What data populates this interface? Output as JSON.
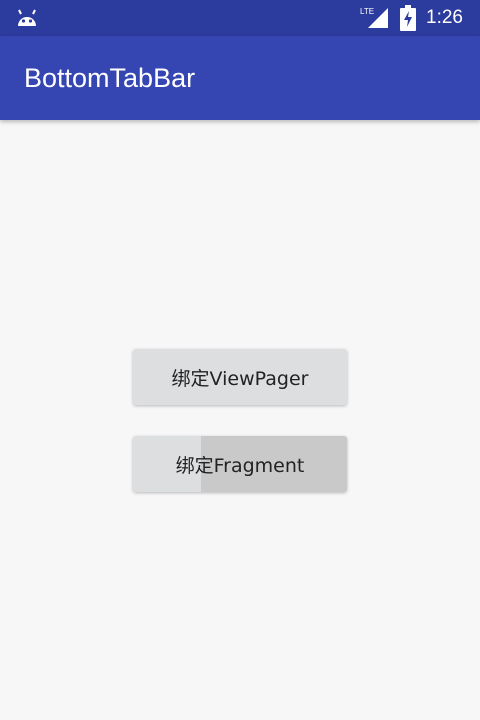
{
  "status_bar": {
    "time": "1:26",
    "network_label": "LTE",
    "icons": [
      "android-icon",
      "lte-signal-icon",
      "battery-charging-icon"
    ]
  },
  "app_bar": {
    "title": "BottomTabBar"
  },
  "buttons": {
    "bind_viewpager": "绑定ViewPager",
    "bind_fragment": "绑定Fragment"
  },
  "colors": {
    "status_bar": "#2c3b9e",
    "app_bar": "#3546b2",
    "background": "#f7f7f8",
    "button": "#dcdee0"
  }
}
